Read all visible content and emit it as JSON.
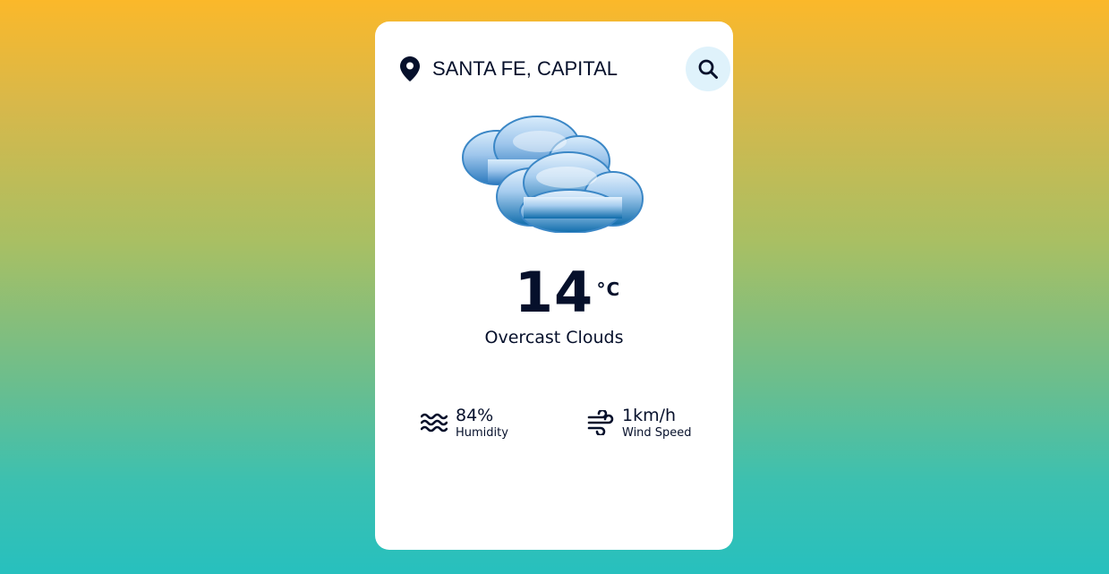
{
  "search": {
    "location_value": "SANTA FE, CAPITAL",
    "location_icon": "map-pin-icon",
    "search_icon": "magnifier-icon"
  },
  "weather": {
    "icon": "clouds-icon",
    "temperature": "14",
    "unit": "°C",
    "description": "Overcast Clouds"
  },
  "details": {
    "humidity": {
      "value": "84%",
      "label": "Humidity",
      "icon": "waves-icon"
    },
    "wind": {
      "value": "1km/h",
      "label": "Wind Speed",
      "icon": "wind-icon"
    }
  },
  "colors": {
    "text": "#06102b",
    "search_button_bg": "#dff2fb",
    "card_bg": "#ffffff",
    "gradient_top": "#fbb82a",
    "gradient_bottom": "#27c0be"
  }
}
